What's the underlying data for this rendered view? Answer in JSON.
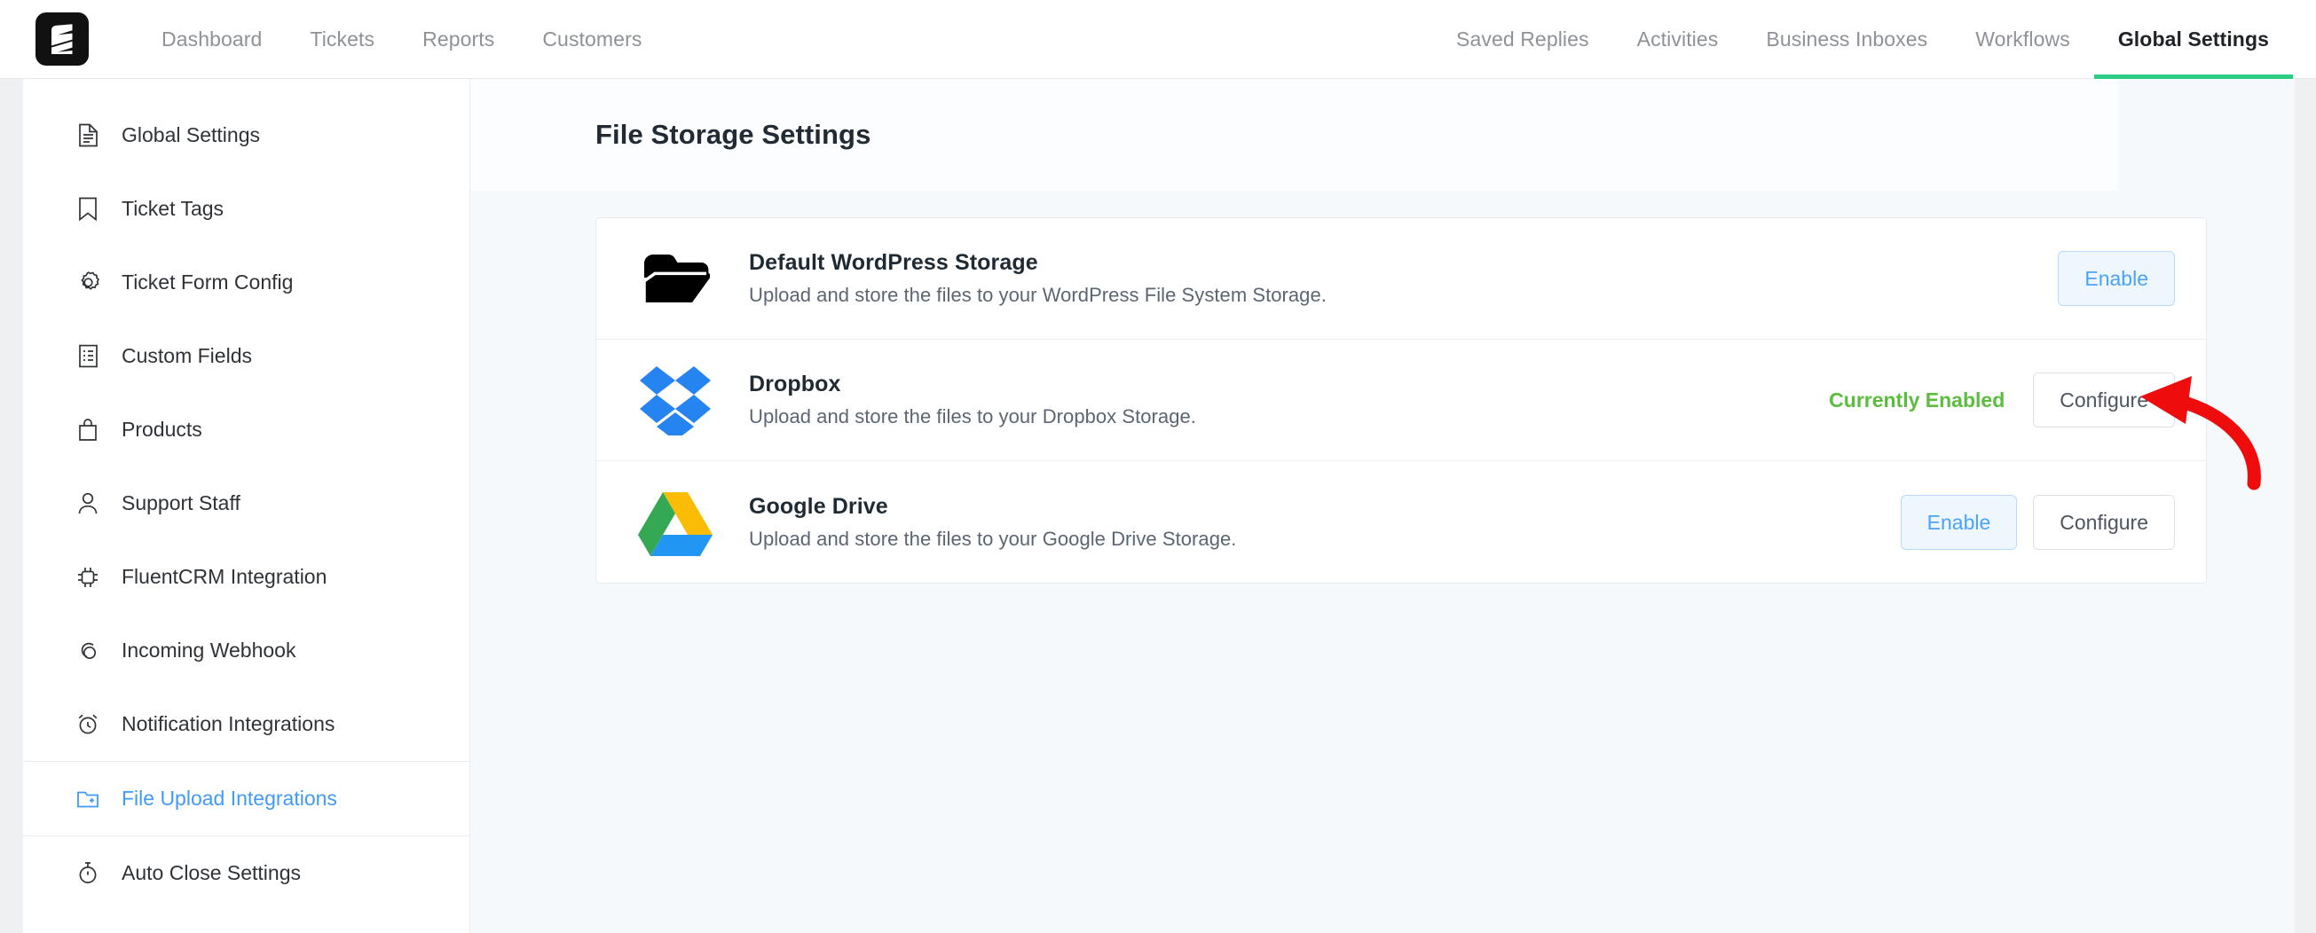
{
  "topnav": {
    "logo_icon": "fluent-support-logo-icon",
    "left_items": [
      {
        "label": "Dashboard",
        "active": false
      },
      {
        "label": "Tickets",
        "active": false
      },
      {
        "label": "Reports",
        "active": false
      },
      {
        "label": "Customers",
        "active": false
      }
    ],
    "right_items": [
      {
        "label": "Saved Replies",
        "active": false
      },
      {
        "label": "Activities",
        "active": false
      },
      {
        "label": "Business Inboxes",
        "active": false
      },
      {
        "label": "Workflows",
        "active": false
      },
      {
        "label": "Global Settings",
        "active": true
      }
    ],
    "active_underline_color": "#2bcd84"
  },
  "sidebar": {
    "items": [
      {
        "label": "Global Settings",
        "icon": "document-text-icon",
        "active": false
      },
      {
        "label": "Ticket Tags",
        "icon": "bookmark-icon",
        "active": false
      },
      {
        "label": "Ticket Form Config",
        "icon": "gear-icon",
        "active": false
      },
      {
        "label": "Custom Fields",
        "icon": "list-document-icon",
        "active": false
      },
      {
        "label": "Products",
        "icon": "shopping-bag-icon",
        "active": false
      },
      {
        "label": "Support Staff",
        "icon": "user-icon",
        "active": false
      },
      {
        "label": "FluentCRM Integration",
        "icon": "chip-icon",
        "active": false
      },
      {
        "label": "Incoming Webhook",
        "icon": "webhook-icon",
        "active": false
      },
      {
        "label": "Notification Integrations",
        "icon": "alarm-clock-icon",
        "active": false
      },
      {
        "label": "File Upload Integrations",
        "icon": "folder-plus-icon",
        "active": true
      },
      {
        "label": "Auto Close Settings",
        "icon": "stopwatch-icon",
        "active": false
      }
    ],
    "active_color": "#3f9bf5"
  },
  "main": {
    "page_title": "File Storage Settings",
    "storage_rows": [
      {
        "icon": "black-folder-icon",
        "title": "Default WordPress Storage",
        "description": "Upload and store the files to your WordPress File System Storage.",
        "status": "",
        "buttons": [
          {
            "label": "Enable",
            "style": "enable"
          }
        ]
      },
      {
        "icon": "dropbox-icon",
        "title": "Dropbox",
        "description": "Upload and store the files to your Dropbox Storage.",
        "status": "Currently Enabled",
        "buttons": [
          {
            "label": "Configure",
            "style": "configure"
          }
        ]
      },
      {
        "icon": "google-drive-icon",
        "title": "Google Drive",
        "description": "Upload and store the files to your Google Drive Storage.",
        "status": "",
        "buttons": [
          {
            "label": "Enable",
            "style": "enable"
          },
          {
            "label": "Configure",
            "style": "configure"
          }
        ]
      }
    ],
    "status_color": "#5bbd3e"
  },
  "annotation": {
    "arrow_color": "#ef0c0c",
    "points_to": "Configure"
  }
}
